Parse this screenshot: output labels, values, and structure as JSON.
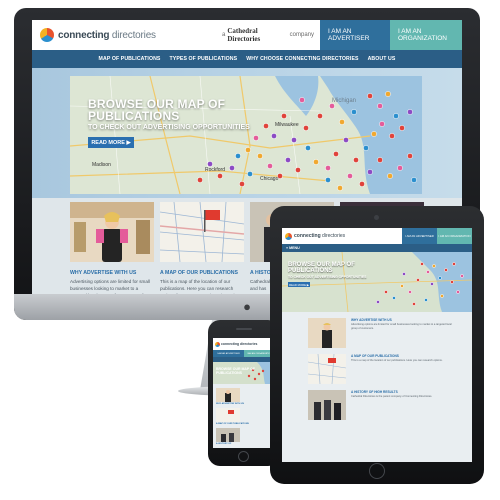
{
  "brand": {
    "logo_bold": "connecting",
    "logo_light": " directories",
    "tagline_prefix": "a",
    "tagline_company": "Cathedral Directories",
    "tagline_suffix": "company"
  },
  "header_buttons": {
    "advertiser": "I AM AN ADVERTISER",
    "organization": "I AM AN ORGANIZATION"
  },
  "nav": {
    "items": [
      "MAP OF PUBLICATIONS",
      "TYPES OF PUBLICATIONS",
      "WHY CHOOSE CONNECTING DIRECTORIES",
      "ABOUT US"
    ]
  },
  "hero": {
    "title_line1": "BROWSE OUR MAP OF",
    "title_line2": "PUBLICATIONS",
    "subtitle": "TO CHECK OUT ADVERTISING OPPORTUNITIES",
    "read_more": "READ MORE ▶",
    "map_labels": [
      "Michigan",
      "Chicago",
      "Madison",
      "Rockford",
      "Milwaukee"
    ]
  },
  "cards": [
    {
      "title": "WHY ADVERTISE WITH US",
      "body": "Advertising options are limited for small businesses looking to market to a targeted local group of customers. If you want to get"
    },
    {
      "title": "A MAP OF OUR PUBLICATIONS",
      "body": "This is a map of the location of our publications. Here you can research options for your Connecting Directories"
    },
    {
      "title": "A HISTORY OF",
      "body": "Cathedral Direc of Connecting D in 1946 and has"
    }
  ],
  "ipad": {
    "nav_label": "≡ MENU",
    "rows": [
      {
        "title": "WHY ADVERTISE WITH US",
        "body": "Advertising options are limited for small businesses looking to market to a targeted local group of customers."
      },
      {
        "title": "A MAP OF OUR PUBLICATIONS",
        "body": "This is a map of the location of our publications. Here you can research options."
      },
      {
        "title": "A HISTORY OF HIGH RESULTS",
        "body": "Cathedral Directories is the parent company of Connecting Directories."
      }
    ]
  },
  "iphone": {
    "nav_label": "≡ MENU"
  },
  "colors": {
    "nav_blue": "#2b5e86",
    "advertiser_button": "#2f6f9c",
    "organization_button": "#62b7b0",
    "accent_link": "#2a6ea8",
    "read_more": "#2a6fb0"
  },
  "icons": [
    "logo-mark-icon",
    "apple-logo-icon",
    "map-pin-icon",
    "play-arrow-icon"
  ]
}
